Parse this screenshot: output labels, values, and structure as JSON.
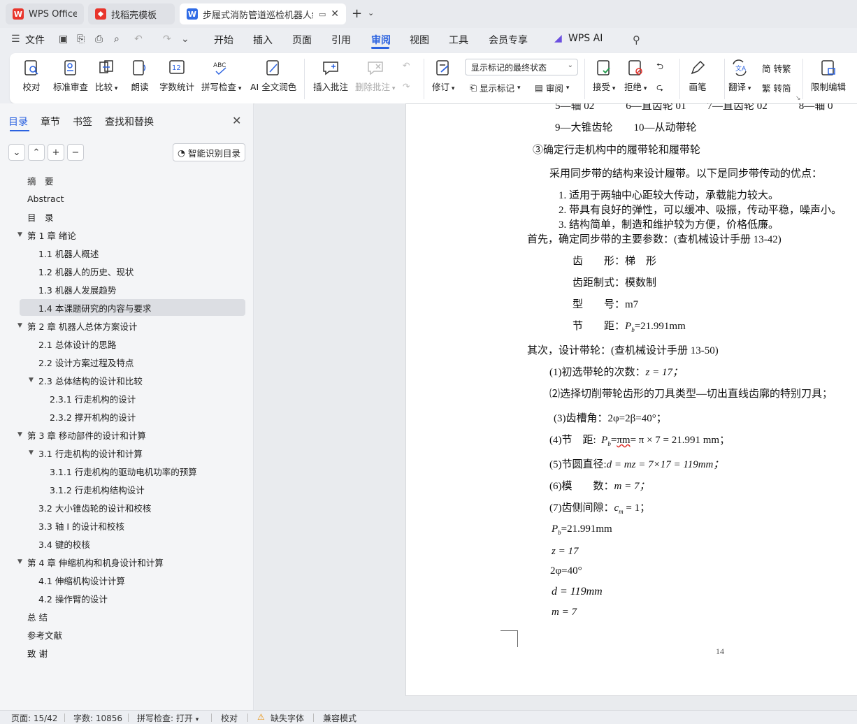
{
  "tabs": [
    {
      "label": "WPS Office",
      "icon": "wps-logo"
    },
    {
      "label": "找稻壳模板",
      "icon": "docer-logo"
    },
    {
      "label": "步履式消防管道巡检机器人结",
      "icon": "writer-logo"
    }
  ],
  "menu": {
    "file": "文件",
    "items": [
      "开始",
      "插入",
      "页面",
      "引用",
      "审阅",
      "视图",
      "工具",
      "会员专享"
    ],
    "active": "审阅",
    "ai": "WPS AI"
  },
  "ribbon": {
    "proofread": "校对",
    "standard_review": "标准审查",
    "compare": "比较",
    "read_aloud": "朗读",
    "word_count": "字数统计",
    "spell_check": "拼写检查",
    "ai_polish": "AI 全文润色",
    "insert_comment": "插入批注",
    "delete_comment": "删除批注",
    "revise": "修订",
    "markup_select": "显示标记的最终状态",
    "show_markup": "显示标记",
    "review": "审阅",
    "accept": "接受",
    "reject": "拒绝",
    "pen": "画笔",
    "translate": "翻译",
    "to_traditional": "简 转繁",
    "to_simplified": "繁 转简",
    "restrict": "限制编辑",
    "icon_abc": "ABC",
    "icon_12": "12"
  },
  "panel": {
    "tabs": [
      "目录",
      "章节",
      "书签",
      "查找和替换"
    ],
    "smart_toc": "智能识别目录",
    "toc": [
      {
        "label": "摘　要",
        "level": 0,
        "arrow": ""
      },
      {
        "label": "Abstract",
        "level": 0,
        "arrow": ""
      },
      {
        "label": "目　录",
        "level": 0,
        "arrow": ""
      },
      {
        "label": "第 1 章  绪论",
        "level": 0,
        "arrow": "▼"
      },
      {
        "label": "1.1  机器人概述",
        "level": 1,
        "arrow": ""
      },
      {
        "label": "1.2  机器人的历史、现状",
        "level": 1,
        "arrow": ""
      },
      {
        "label": "1.3 机器人发展趋势",
        "level": 1,
        "arrow": ""
      },
      {
        "label": "1.4  本课题研究的内容与要求",
        "level": 1,
        "arrow": "",
        "selected": true
      },
      {
        "label": "第 2 章  机器人总体方案设计",
        "level": 0,
        "arrow": "▼"
      },
      {
        "label": "2.1 总体设计的思路",
        "level": 1,
        "arrow": ""
      },
      {
        "label": "2.2  设计方案过程及特点",
        "level": 1,
        "arrow": ""
      },
      {
        "label": "2.3  总体结构的设计和比较",
        "level": 1,
        "arrow": "▼"
      },
      {
        "label": "2.3.1  行走机构的设计",
        "level": 2,
        "arrow": ""
      },
      {
        "label": "2.3.2  撑开机构的设计",
        "level": 2,
        "arrow": ""
      },
      {
        "label": "第 3 章  移动部件的设计和计算",
        "level": 0,
        "arrow": "▼"
      },
      {
        "label": "3.1  行走机构的设计和计算",
        "level": 1,
        "arrow": "▼"
      },
      {
        "label": "3.1.1  行走机构的驱动电机功率的预算",
        "level": 2,
        "arrow": ""
      },
      {
        "label": "3.1.2  行走机构结构设计",
        "level": 2,
        "arrow": ""
      },
      {
        "label": "3.2 大小锥齿轮的设计和校核",
        "level": 1,
        "arrow": ""
      },
      {
        "label": "3.3  轴 I 的设计和校核",
        "level": 1,
        "arrow": ""
      },
      {
        "label": "3.4  键的校核",
        "level": 1,
        "arrow": ""
      },
      {
        "label": "第 4 章  伸缩机构和机身设计和计算",
        "level": 0,
        "arrow": "▼"
      },
      {
        "label": "4.1  伸缩机构设计计算",
        "level": 1,
        "arrow": ""
      },
      {
        "label": "4.2  操作臂的设计",
        "level": 1,
        "arrow": ""
      },
      {
        "label": "总  结",
        "level": 0,
        "arrow": ""
      },
      {
        "label": "参考文献",
        "level": 0,
        "arrow": ""
      },
      {
        "label": "致  谢",
        "level": 0,
        "arrow": ""
      }
    ]
  },
  "doc": {
    "cut_top": "5—轴 02　　　6—直齿轮 01　　7—直齿轮 02　　　8—轴 0",
    "legend_9_10": "9—大锥齿轮　　10—从动带轮",
    "heading3": "③确定行走机构中的履带轮和履带轮",
    "intro": "采用同步带的结构来设计履带。以下是同步带传动的优点：",
    "advantages": [
      "1.  适用于两轴中心距较大传动，承载能力较大。",
      "2.  带具有良好的弹性，可以缓冲、吸振，传动平稳，噪声小。",
      "3.  结构简单，制造和维护较为方便，价格低廉。"
    ],
    "first": "首先，确定同步带的主要参数：(查机械设计手册 13-42)",
    "params": {
      "tooth_shape": "齿　　形：梯　形",
      "pitch_system": "齿距制式：模数制",
      "model": "型　　号：m7",
      "pitch_label": "节　　距：",
      "pitch_val": "=21.991mm"
    },
    "second": "其次，设计带轮：(查机械设计手册 13-50)",
    "steps": {
      "s1_label": "(1)初选带轮的次数：",
      "s1_val": "z = 17；",
      "s2": "⑵选择切削带轮齿形的刀具类型—切出直线齿廓的特别刀具；",
      "s3": "(3)齿槽角：2φ=2β=40°；",
      "s4_label": "(4)节　距:",
      "s4_p": "P",
      "s4_sub": "b",
      "s4_eq": "=",
      "s4_pim": "πm",
      "s4_rest": "= π × 7 = 21.991 mm；",
      "s5_label": "(5)节圆直径:",
      "s5_val": "d = mz = 7×17 = 119mm；",
      "s6_label": "(6)模　　数：",
      "s6_val": "m = 7；",
      "s7_label": "(7)齿侧间隙：",
      "s7_c": "c",
      "s7_sub": "m",
      "s7_val": " = 1；"
    },
    "summary": {
      "p_sym": "P",
      "p_sub": "b",
      "p_val": "=21.991mm",
      "z": "z = 17",
      "phi": "2φ=40°",
      "d": "d = 119mm",
      "m": "m = 7"
    },
    "page_number": "14"
  },
  "status": {
    "page": "页面: 15/42",
    "words": "字数: 10856",
    "spell": "拼写检查: 打开",
    "proof": "校对",
    "missing_font": "缺失字体",
    "compat": "兼容模式"
  },
  "colors": {
    "accent": "#2b62e0",
    "wps_red": "#e8352c",
    "writer_blue": "#2f6be6"
  }
}
